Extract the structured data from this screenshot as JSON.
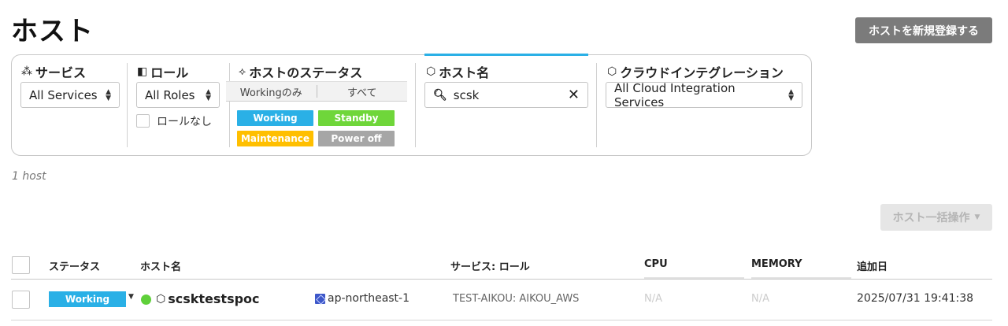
{
  "page": {
    "title": "ホスト",
    "register_button": "ホストを新規登録する",
    "host_count": "1 host",
    "bulk_button": "ホスト一括操作",
    "bulk_caret": "▼"
  },
  "filters": {
    "service": {
      "label": "サービス",
      "icon": "services-icon",
      "value": "All Services"
    },
    "role": {
      "label": "ロール",
      "icon": "role-icon",
      "value": "All Roles",
      "no_role_label": "ロールなし"
    },
    "status": {
      "label": "ホストのステータス",
      "icon": "status-icon",
      "segments": [
        "Workingのみ",
        "すべて"
      ],
      "tags": [
        {
          "label": "Working",
          "color": "#2ab0e6"
        },
        {
          "label": "Standby",
          "color": "#6fd63a"
        },
        {
          "label": "Maintenance",
          "color": "#ffbf00"
        },
        {
          "label": "Power off",
          "color": "#a6a6a6"
        }
      ]
    },
    "host_name": {
      "label": "ホスト名",
      "icon": "host-icon",
      "value": "scsk"
    },
    "cloud": {
      "label": "クラウドインテグレーション",
      "icon": "cloud-icon",
      "value": "All Cloud Integration Services"
    }
  },
  "table": {
    "headers": {
      "status": "ステータス",
      "host": "ホスト名",
      "service": "サービス: ロール",
      "cpu": "CPU",
      "memory": "MEMORY",
      "added": "追加日"
    },
    "rows": [
      {
        "status": "Working",
        "host": "scsktestspoc",
        "region": "ap-northeast-1",
        "service_role": "TEST-AIKOU: AIKOU_AWS",
        "cpu": "N/A",
        "memory": "N/A",
        "added": "2025/07/31 19:41:38"
      }
    ]
  }
}
